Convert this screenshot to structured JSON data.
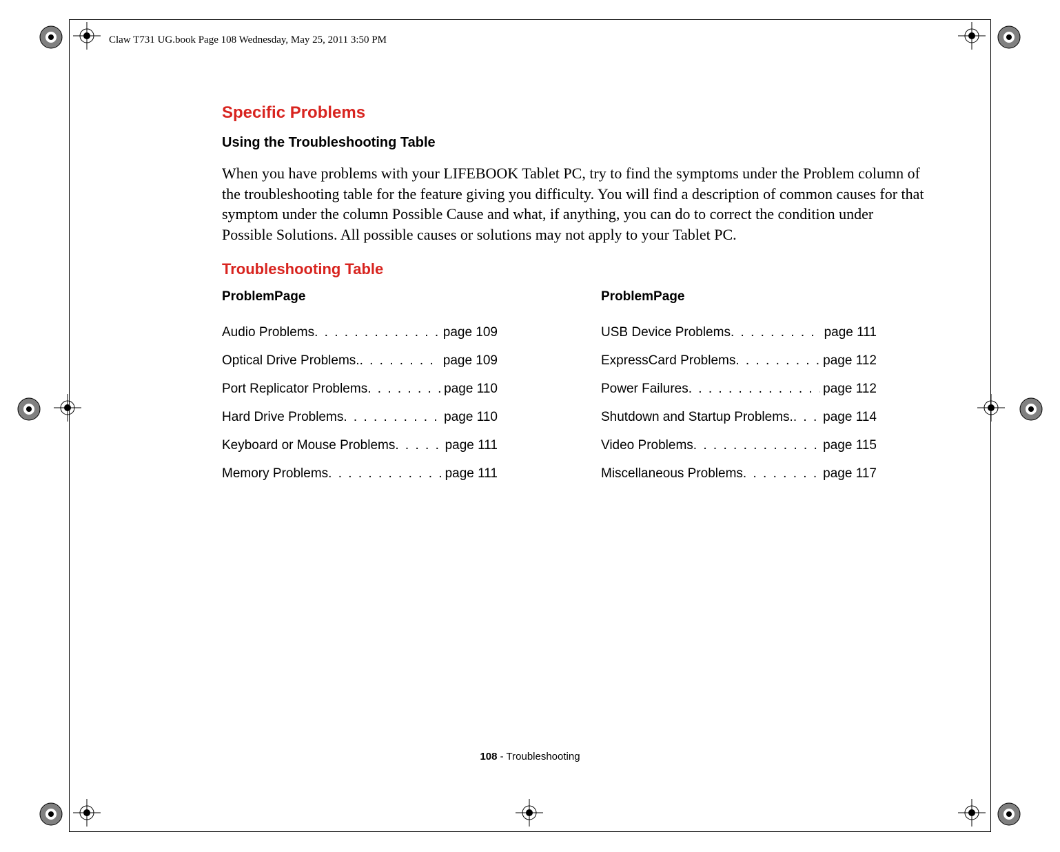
{
  "header_running": "Claw T731 UG.book  Page 108  Wednesday, May 25, 2011  3:50 PM",
  "section_title": "Specific Problems",
  "subsection_title": "Using the Troubleshooting Table",
  "body_paragraph": "When you have problems with your LIFEBOOK Tablet PC, try to find the symptoms under the Problem column of the troubleshooting table for the feature giving you difficulty. You will find a description of common causes for that symptom under the column Possible Cause and what, if anything, you can do to correct the condition under Possible Solutions. All possible causes or solutions may not apply to your Tablet PC.",
  "table_title": "Troubleshooting Table",
  "toc_header_problem": "Problem",
  "toc_header_page": "Page",
  "toc_left": [
    {
      "label": "Audio Problems",
      "page": "page 109"
    },
    {
      "label": "Optical Drive Problems.",
      "page": "page 109"
    },
    {
      "label": "Port Replicator Problems",
      "page": "page 110"
    },
    {
      "label": "Hard Drive Problems",
      "page": "page 110"
    },
    {
      "label": "Keyboard or Mouse Problems",
      "page": "page 111"
    },
    {
      "label": "Memory Problems",
      "page": "page 111"
    }
  ],
  "toc_right": [
    {
      "label": "USB Device Problems",
      "page": "page 111"
    },
    {
      "label": "ExpressCard Problems",
      "page": "page 112"
    },
    {
      "label": "Power Failures",
      "page": "page 112"
    },
    {
      "label": "Shutdown and Startup Problems.",
      "page": "page 114"
    },
    {
      "label": "Video Problems",
      "page": "page 115"
    },
    {
      "label": "Miscellaneous Problems",
      "page": "page 117"
    }
  ],
  "footer_page_number": "108",
  "footer_section": " - Troubleshooting"
}
